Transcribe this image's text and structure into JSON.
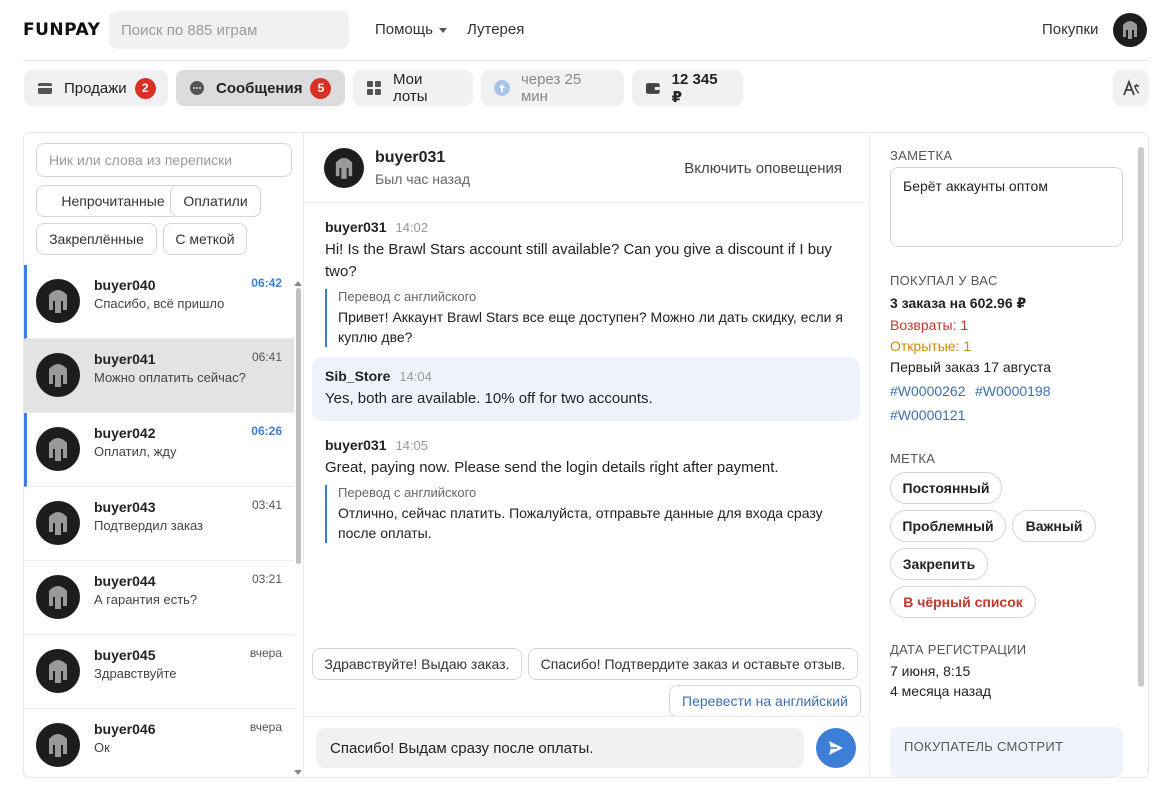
{
  "header": {
    "logo_left": "FU",
    "logo_right": "PAY",
    "search_placeholder": "Поиск по 885 играм",
    "help": "Помощь",
    "lottery": "Лутерея",
    "purchases": "Покупки"
  },
  "tabs": {
    "sales": {
      "label": "Продажи",
      "badge": "2"
    },
    "messages": {
      "label": "Сообщения",
      "badge": "5"
    },
    "lots": {
      "label": "Мои лоты"
    },
    "timer": {
      "label": "через 25 мин"
    },
    "balance": {
      "label": "12 345 ₽"
    }
  },
  "chats": {
    "search_placeholder": "Ник или слова из переписки",
    "filters": [
      "Непрочитанные",
      "Оплатили",
      "Закреплённые",
      "С меткой"
    ],
    "items": [
      {
        "name": "buyer040",
        "message": "Спасибо, всё пришло",
        "time": "06:42"
      },
      {
        "name": "buyer041",
        "message": "Можно оплатить сейчас?",
        "time": "06:41"
      },
      {
        "name": "buyer042",
        "message": "Оплатил, жду",
        "time": "06:26"
      },
      {
        "name": "buyer043",
        "message": "Подтвердил заказ",
        "time": "03:41"
      },
      {
        "name": "buyer044",
        "message": "А гарантия есть?",
        "time": "03:21"
      },
      {
        "name": "buyer045",
        "message": "Здравствуйте",
        "time": "вчера"
      },
      {
        "name": "buyer046",
        "message": "Ок",
        "time": "вчера"
      }
    ]
  },
  "conversation": {
    "name": "buyer031",
    "status": "Был час назад",
    "notify": "Включить оповещения",
    "messages": [
      {
        "author": "buyer031",
        "time": "14:02",
        "text": "Hi! Is the Brawl Stars account still available? Can you give a discount if I buy two?",
        "translation_label": "Перевод с английского",
        "translation": "Привет! Аккаунт Brawl Stars все еще доступен? Можно ли дать скидку, если я куплю две?"
      },
      {
        "author": "Sib_Store",
        "time": "14:04",
        "text": "Yes, both are available. 10% off for two accounts."
      },
      {
        "author": "buyer031",
        "time": "14:05",
        "text": "Great, paying now. Please send the login details right after payment.",
        "translation_label": "Перевод с английского",
        "translation": "Отлично, сейчас платить. Пожалуйста, отправьте данные для входа сразу после оплаты."
      }
    ],
    "quick_replies": [
      "Здравствуйте! Выдаю заказ.",
      "Спасибо! Подтвердите заказ и оставьте отзыв."
    ],
    "translate_button": "Перевести на английский",
    "composer_value": "Спасибо! Выдам сразу после оплаты."
  },
  "sidebar": {
    "note_title": "ЗАМЕТКА",
    "note_value": "Берёт аккаунты оптом",
    "bought_title": "ПОКУПАЛ У ВАС",
    "bought_summary": "3 заказа на 602.96 ₽",
    "returns": "Возвраты: 1",
    "open": "Открытые: 1",
    "first_order": "Первый заказ 17 августа",
    "orders": [
      "#W0000262",
      "#W0000198",
      "#W0000121"
    ],
    "tag_title": "МЕТКА",
    "tags": [
      "Постоянный",
      "Проблемный",
      "Важный",
      "Закрепить",
      "В чёрный список"
    ],
    "reg_title": "ДАТА РЕГИСТРАЦИИ",
    "reg_date": "7 июня, 8:15",
    "reg_ago": "4 месяца назад",
    "watching": "ПОКУПАТЕЛЬ СМОТРИТ"
  },
  "colors": {
    "accent": "#3d7fd6",
    "badge": "#d93025",
    "danger": "#c0392b",
    "warning": "#d08a0a"
  }
}
